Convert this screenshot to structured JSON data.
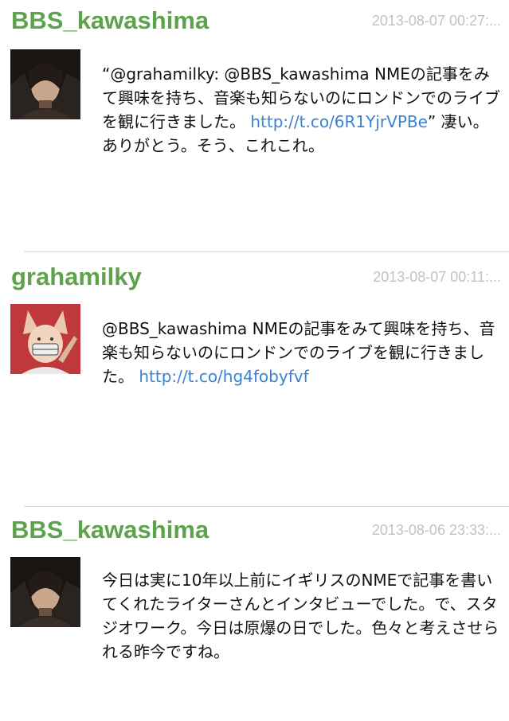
{
  "tweets": [
    {
      "username": "BBS_kawashima",
      "timestamp": "2013-08-07 00:27:...",
      "avatar_icon": "avatar-bbs-kawashima",
      "text_before": "“@grahamilky: @BBS_kawashima NMEの記事をみて興味を持ち、音楽も知らないのにロンドンでのライブを観に行きました。 ",
      "link": "http://t.co/6R1YjrVPBe",
      "text_after": "” 凄い。ありがとう。そう、これこれ。"
    },
    {
      "username": "grahamilky",
      "timestamp": "2013-08-07 00:11:...",
      "avatar_icon": "avatar-grahamilky",
      "text_before": "@BBS_kawashima NMEの記事をみて興味を持ち、音楽も知らないのにロンドンでのライブを観に行きました。 ",
      "link": "http://t.co/hg4fobyfvf",
      "text_after": ""
    },
    {
      "username": "BBS_kawashima",
      "timestamp": "2013-08-06 23:33:...",
      "avatar_icon": "avatar-bbs-kawashima",
      "text_before": "今日は実に10年以上前にイギリスのNMEで記事を書いてくれたライターさんとインタビューでした。で、スタジオワーク。今日は原爆の日でした。色々と考えさせられる昨今ですね。",
      "link": "",
      "text_after": ""
    }
  ],
  "colors": {
    "username": "#5fa24d",
    "timestamp": "#c2c2c2",
    "link": "#3a82d6",
    "divider": "#d9d9d9"
  }
}
